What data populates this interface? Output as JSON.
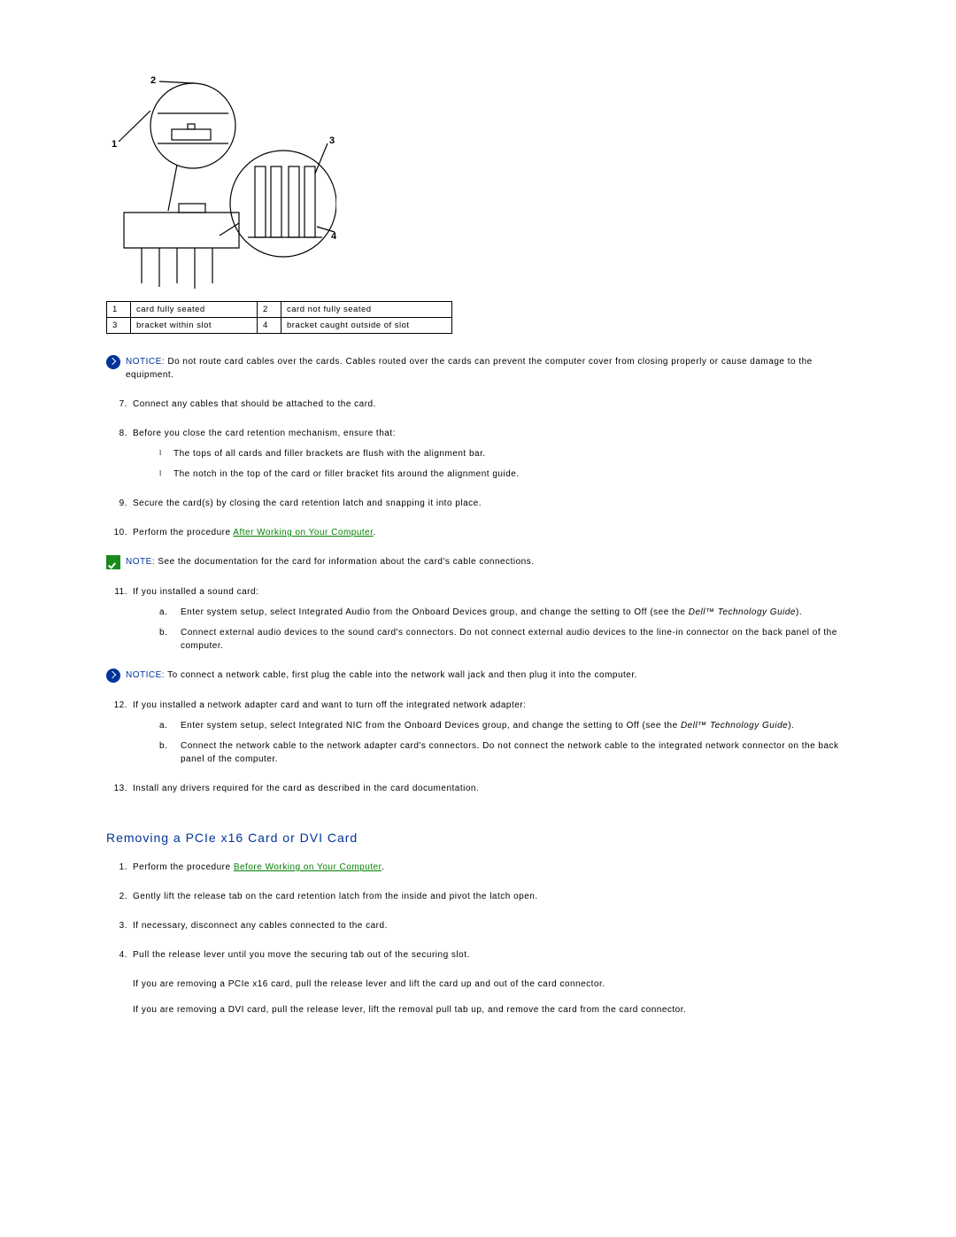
{
  "diagram": {
    "callouts": {
      "c1": "1",
      "c2": "2",
      "c3": "3",
      "c4": "4"
    }
  },
  "legend": {
    "r1n1": "1",
    "r1d1": "card fully seated",
    "r1n2": "2",
    "r1d2": "card not fully seated",
    "r2n1": "3",
    "r2d1": "bracket within slot",
    "r2n2": "4",
    "r2d2": "bracket caught outside of slot"
  },
  "notice1": {
    "label": "NOTICE: ",
    "text": "Do not route card cables over the cards. Cables routed over the cards can prevent the computer cover from closing properly or cause damage to the equipment."
  },
  "steps": {
    "s7n": "7.",
    "s7": "Connect any cables that should be attached to the card.",
    "s8n": "8.",
    "s8": "Before you close the card retention mechanism, ensure that:",
    "s8a": "The tops of all cards and filler brackets are flush with the alignment bar.",
    "s8b": "The notch in the top of the card or filler bracket fits around the alignment guide.",
    "s9n": "9.",
    "s9": "Secure the card(s) by closing the card retention latch and snapping it into place.",
    "s10n": "10.",
    "s10a": "Perform the procedure ",
    "s10link": "After Working on Your Computer",
    "s10b": ".",
    "s11n": "11.",
    "s11": "If you installed a sound card:",
    "s11a_n": "a.",
    "s11a_1": "Enter system setup, select Integrated Audio from the Onboard Devices group, and change the setting to Off (see the ",
    "s11a_i": "Dell",
    "s11a_tm": "™",
    "s11a_i2": " Technology Guide",
    "s11a_2": ").",
    "s11b_n": "b.",
    "s11b": "Connect external audio devices to the sound card's connectors. Do not connect external audio devices to the line-in connector on the back panel of the computer.",
    "s12n": "12.",
    "s12": "If you installed a network adapter card and want to turn off the integrated network adapter:",
    "s12a_n": "a.",
    "s12a_1": "Enter system setup, select Integrated NIC from the Onboard Devices group, and change the setting to Off (see the ",
    "s12a_i": "Dell",
    "s12a_tm": "™",
    "s12a_i2": " Technology Guide",
    "s12a_2": ").",
    "s12b_n": "b.",
    "s12b": "Connect the network cable to the network adapter card's connectors. Do not connect the network cable to the integrated network connector on the back panel of the computer.",
    "s13n": "13.",
    "s13": "Install any drivers required for the card as described in the card documentation."
  },
  "note1": {
    "label": "NOTE: ",
    "text": "See the documentation for the card for information about the card's cable connections."
  },
  "notice2": {
    "label": "NOTICE: ",
    "text": "To connect a network cable, first plug the cable into the network wall jack and then plug it into the computer."
  },
  "heading": "Removing a PCIe x16 Card or DVI Card",
  "steps2": {
    "s1n": "1.",
    "s1a": "Perform the procedure ",
    "s1link": "Before Working on Your Computer",
    "s1b": ".",
    "s2n": "2.",
    "s2": "Gently lift the release tab on the card retention latch from the inside and pivot the latch open.",
    "s3n": "3.",
    "s3": "If necessary, disconnect any cables connected to the card.",
    "s4n": "4.",
    "s4": "Pull the release lever until you move the securing tab out of the securing slot.",
    "p1": "If you are removing a PCIe x16 card, pull the release lever and lift the card up and out of the card connector.",
    "p2": "If you are removing a DVI card, pull the release lever, lift the removal pull tab up, and remove the card from the card connector."
  }
}
